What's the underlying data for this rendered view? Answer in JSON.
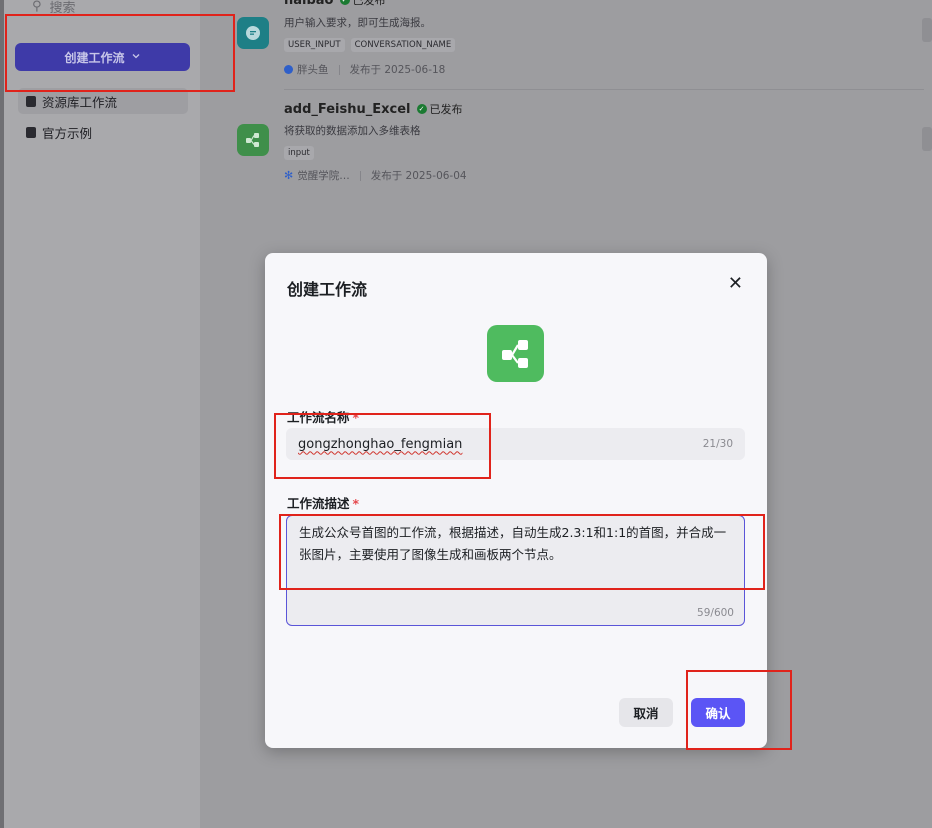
{
  "sidebar": {
    "search_placeholder": "搜索",
    "create_button": "创建工作流",
    "items": [
      {
        "label": "资源库工作流"
      },
      {
        "label": "官方示例"
      }
    ]
  },
  "workflows": [
    {
      "name": "haibao",
      "status": "已发布",
      "description": "用户输入要求，即可生成海报。",
      "tags": [
        "USER_INPUT",
        "CONVERSATION_NAME"
      ],
      "author": "胖头鱼",
      "published_at": "发布于 2025-06-18"
    },
    {
      "name": "add_Feishu_Excel",
      "status": "已发布",
      "description": "将获取的数据添加入多维表格",
      "tags": [
        "input"
      ],
      "author": "觉醒学院…",
      "published_at": "发布于 2025-06-04"
    }
  ],
  "modal": {
    "title": "创建工作流",
    "name_label": "工作流名称",
    "name_value": "gongzhonghao_fengmian",
    "name_counter": "21/30",
    "desc_label": "工作流描述",
    "desc_value": "生成公众号首图的工作流，根据描述，自动生成2.3:1和1:1的首图，并合成一张图片，主要使用了图像生成和画板两个节点。",
    "desc_counter": "59/600",
    "required_mark": "*",
    "cancel": "取消",
    "confirm": "确认"
  },
  "colors": {
    "accent": "#5b55f5",
    "workflow_icon_green": "#4fbb5f",
    "annotation_red": "#e0231b"
  }
}
